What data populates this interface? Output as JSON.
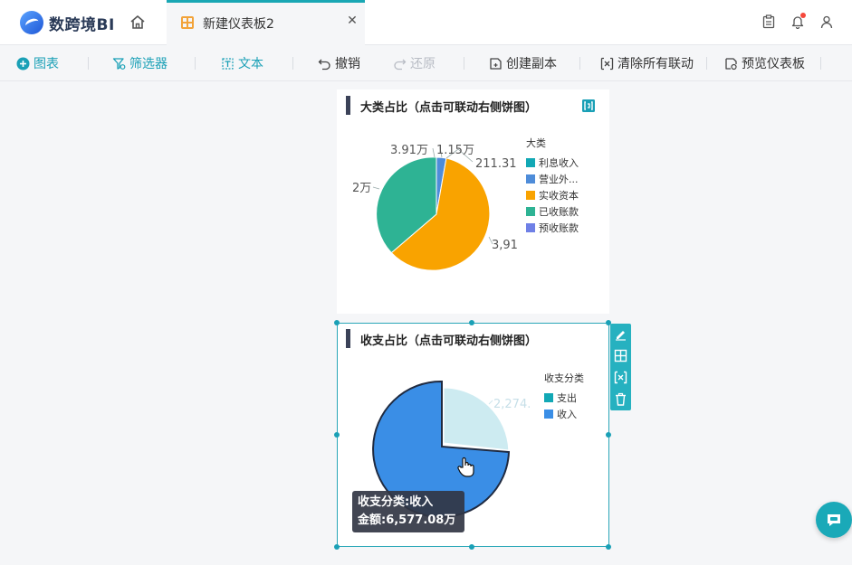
{
  "app": {
    "logo_text": "数跨境BI"
  },
  "tab": {
    "title": "新建仪表板2",
    "close_glyph": "✕"
  },
  "toolbar": {
    "chart": "图表",
    "filter": "筛选器",
    "text": "文本",
    "undo": "撤销",
    "redo": "还原",
    "copy": "创建副本",
    "clear_links": "清除所有联动",
    "preview": "预览仪表板"
  },
  "card1": {
    "title": "大类占比（点击可联动右侧饼图）",
    "legend_title": "大类",
    "legend": [
      {
        "label": "利息收入",
        "color": "#12a8b5"
      },
      {
        "label": "营业外...",
        "color": "#4e8cd9"
      },
      {
        "label": "实收资本",
        "color": "#f9a300"
      },
      {
        "label": "已收账款",
        "color": "#2eb394"
      },
      {
        "label": "预收账款",
        "color": "#6f80e6"
      }
    ],
    "labels": [
      "3.91万",
      "1.15万",
      "211.31",
      "2万",
      "3,91"
    ]
  },
  "card2": {
    "title": "收支占比（点击可联动右侧饼图）",
    "legend_title": "收支分类",
    "legend": [
      {
        "label": "支出",
        "color": "#12a8b5"
      },
      {
        "label": "收入",
        "color": "#3a8ee6"
      }
    ],
    "labels": [
      "2,274."
    ],
    "tooltip": {
      "line1": "收支分类:收入",
      "line2": "金额:6,577.08万"
    }
  },
  "colors": {
    "accent": "#1aa0b6",
    "pie_income": "#3a8ee6",
    "pie_expense_faded": "#cdebf1"
  }
}
